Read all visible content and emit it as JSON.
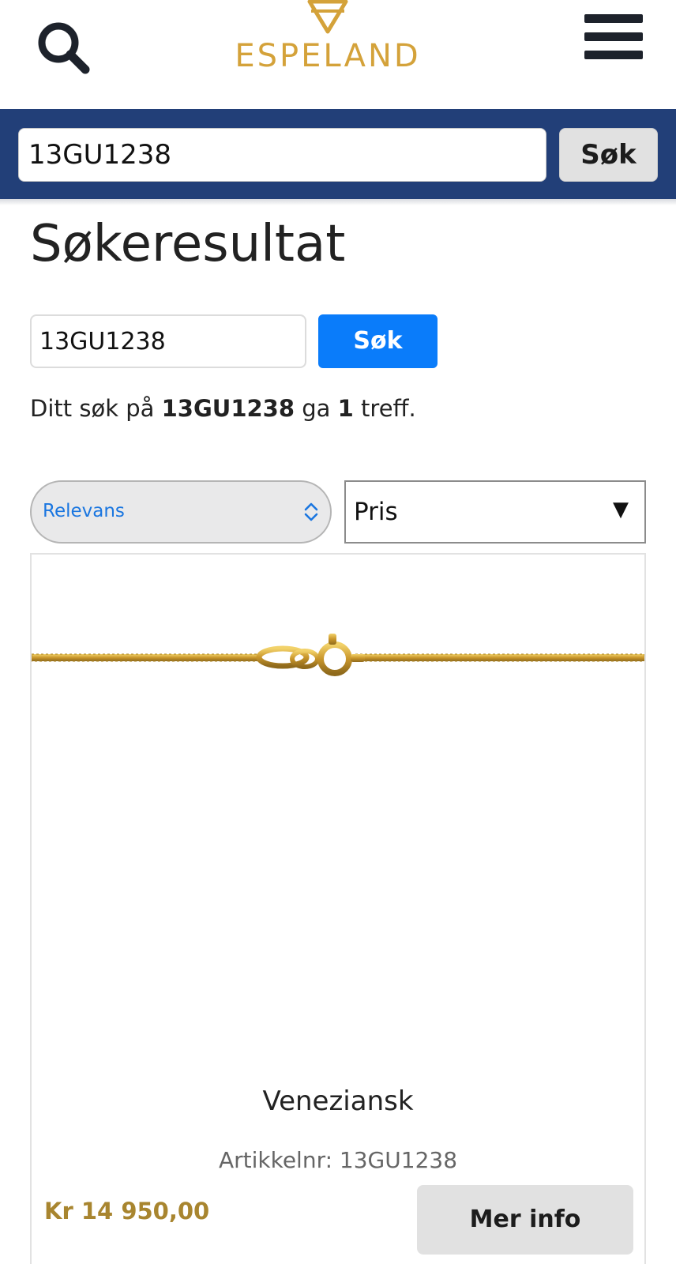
{
  "header": {
    "logo_text": "ESPELAND",
    "brand_color": "#d4a23a"
  },
  "searchbar": {
    "value": "13GU1238",
    "button_label": "Søk",
    "background": "#223f78"
  },
  "page": {
    "title": "Søkeresultat"
  },
  "search_form": {
    "value": "13GU1238",
    "button_label": "Søk",
    "button_color": "#0a7cfa"
  },
  "result_summary": {
    "prefix": "Ditt søk på ",
    "query": "13GU1238",
    "middle": " ga ",
    "count": "1",
    "suffix": " treff."
  },
  "sort": {
    "selected": "Relevans"
  },
  "price_filter": {
    "selected": "Pris",
    "arrow": "▼"
  },
  "products": [
    {
      "name": "Veneziansk",
      "sku_label": "Artikkelnr: 13GU1238",
      "price": "Kr 14 950,00",
      "button_label": "Mer info",
      "image": "gold-chain-necklace"
    }
  ]
}
